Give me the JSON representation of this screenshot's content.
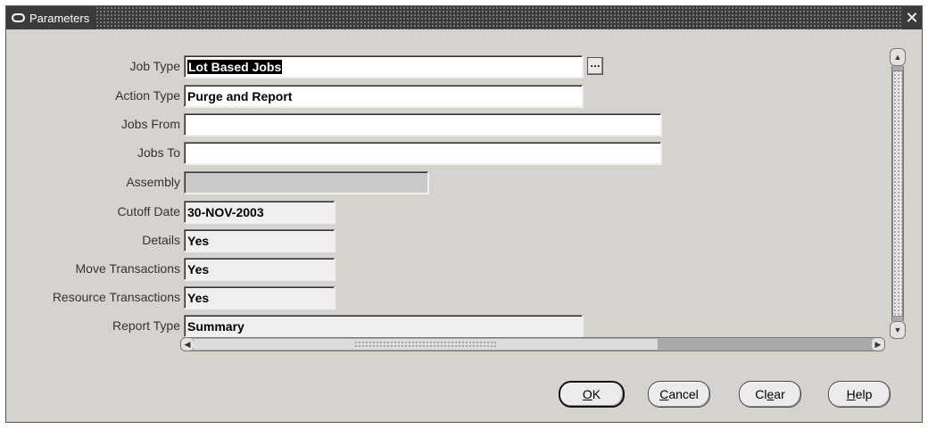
{
  "window": {
    "title": "Parameters",
    "close_glyph": "✕"
  },
  "fields": [
    {
      "label": "Job Type",
      "value": "Lot Based Jobs",
      "state": "selected"
    },
    {
      "label": "Action Type",
      "value": "Purge and Report",
      "state": "normal"
    },
    {
      "label": "Jobs From",
      "value": "",
      "state": "normal"
    },
    {
      "label": "Jobs To",
      "value": "",
      "state": "normal"
    },
    {
      "label": "Assembly",
      "value": "",
      "state": "disabled"
    },
    {
      "label": "Cutoff Date",
      "value": "30-NOV-2003",
      "state": "readonly"
    },
    {
      "label": "Details",
      "value": "Yes",
      "state": "readonly"
    },
    {
      "label": "Move Transactions",
      "value": "Yes",
      "state": "readonly"
    },
    {
      "label": "Resource Transactions",
      "value": "Yes",
      "state": "readonly"
    },
    {
      "label": "Report Type",
      "value": "Summary",
      "state": "readonly"
    }
  ],
  "lov_button": {
    "glyph": "…"
  },
  "scroll": {
    "up": "▲",
    "down": "▼",
    "left": "◀",
    "right": "▶"
  },
  "buttons": {
    "ok": {
      "mnemonic": "O",
      "rest": "K"
    },
    "cancel": {
      "mnemonic": "C",
      "rest": "ancel"
    },
    "clear": {
      "pre": "Cl",
      "mnemonic": "e",
      "rest": "ar"
    },
    "help": {
      "mnemonic": "H",
      "rest": "elp"
    }
  }
}
